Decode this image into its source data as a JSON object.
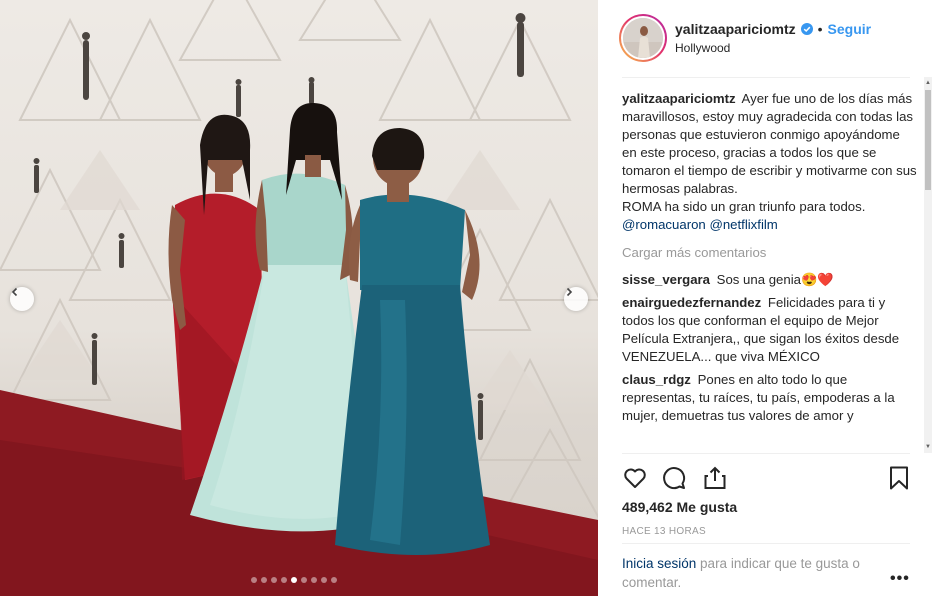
{
  "post": {
    "username": "yalitzaapariciomtz",
    "follow_label": "Seguir",
    "separator": "•",
    "location": "Hollywood",
    "caption_text": "Ayer fue uno de los días más maravillosos, estoy muy agradecida con todas las personas que estuvieron conmigo apoyándome en este proceso, gracias a todos los que se tomaron el tiempo de escribir y motivarme con sus hermosas palabras.",
    "caption_text_2": "ROMA ha sido un gran triunfo para todos.",
    "mention_1": "@romacuaron",
    "mention_2": "@netflixfilm",
    "load_more": "Cargar más comentarios",
    "likes": "489,462 Me gusta",
    "time_ago": "HACE 13 HORAS",
    "login_link": "Inicia sesión",
    "login_text": " para indicar que te gusta o comentar.",
    "more_options": "•••"
  },
  "comments": [
    {
      "user": "sisse_vergara",
      "text": "Sos una genia😍❤️"
    },
    {
      "user": "enairguedezfernandez",
      "text": "Felicidades para ti y todos los que conforman el equipo de Mejor Película Extranjera,, que sigan los éxitos desde VENEZUELA... que viva MÉXICO"
    },
    {
      "user": "claus_rdgz",
      "text": "Pones en alto todo lo que representas, tu raíces, tu país, empoderas a la mujer, demuetras tus valores de amor y"
    }
  ],
  "carousel": {
    "slides": 9,
    "active_index": 4
  },
  "colors": {
    "link_blue": "#3897f0",
    "mention": "#003569",
    "muted": "#999999",
    "text": "#262626",
    "carpet": "#8e1a22"
  },
  "icons": {
    "verified": "verified-badge-icon",
    "like": "heart-icon",
    "comment": "comment-icon",
    "share": "share-icon",
    "save": "bookmark-icon",
    "prev": "chevron-left-icon",
    "next": "chevron-right-icon"
  }
}
